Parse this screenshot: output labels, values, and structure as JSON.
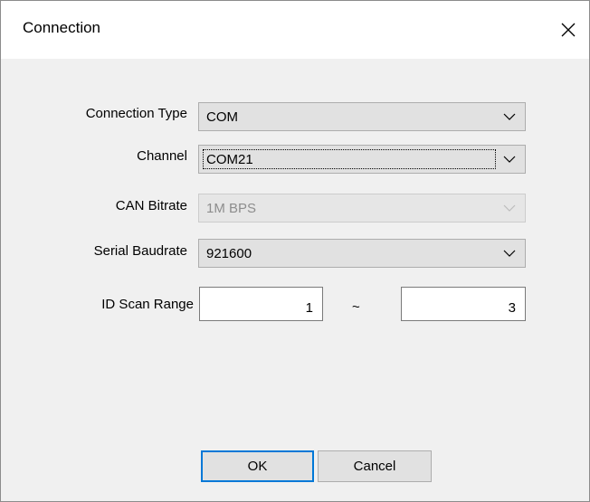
{
  "window": {
    "title": "Connection"
  },
  "form": {
    "connection_type": {
      "label": "Connection Type",
      "value": "COM"
    },
    "channel": {
      "label": "Channel",
      "value": "COM21"
    },
    "can_bitrate": {
      "label": "CAN Bitrate",
      "value": "1M BPS"
    },
    "serial_baudrate": {
      "label": "Serial Baudrate",
      "value": "921600"
    },
    "id_scan_range": {
      "label": "ID Scan Range",
      "from": "1",
      "separator": "~",
      "to": "3"
    }
  },
  "buttons": {
    "ok_label": "OK",
    "cancel_label": "Cancel"
  },
  "colors": {
    "accent": "#0078d7",
    "dialog_background": "#f0f0f0",
    "control_background": "#e1e1e1",
    "disabled_text": "#8d8d8d"
  },
  "icons": {
    "close": "close-icon",
    "dropdown": "chevron-down-icon"
  }
}
